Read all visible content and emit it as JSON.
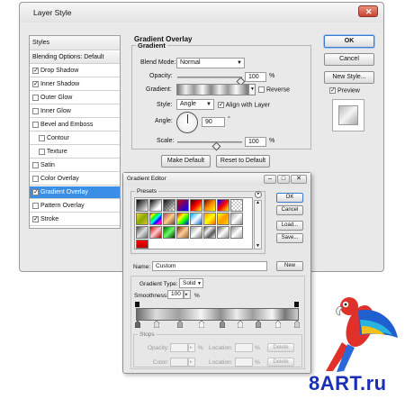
{
  "layer_style": {
    "title": "Layer Style",
    "close_icon": "x-icon",
    "sidebar": {
      "styles_label": "Styles",
      "blending_label": "Blending Options: Default",
      "items": [
        {
          "label": "Drop Shadow",
          "checked": true
        },
        {
          "label": "Inner Shadow",
          "checked": true
        },
        {
          "label": "Outer Glow",
          "checked": false
        },
        {
          "label": "Inner Glow",
          "checked": false
        },
        {
          "label": "Bevel and Emboss",
          "checked": false
        },
        {
          "label": "Contour",
          "checked": false
        },
        {
          "label": "Texture",
          "checked": false
        },
        {
          "label": "Satin",
          "checked": false
        },
        {
          "label": "Color Overlay",
          "checked": false
        },
        {
          "label": "Gradient Overlay",
          "checked": true
        },
        {
          "label": "Pattern Overlay",
          "checked": false
        },
        {
          "label": "Stroke",
          "checked": true
        }
      ]
    },
    "panel": {
      "section_title": "Gradient Overlay",
      "group_title": "Gradient",
      "blend_mode_label": "Blend Mode:",
      "blend_mode_value": "Normal",
      "opacity_label": "Opacity:",
      "opacity_value": "100",
      "opacity_unit": "%",
      "gradient_label": "Gradient:",
      "reverse_label": "Reverse",
      "style_label": "Style:",
      "style_value": "Angle",
      "align_label": "Align with Layer",
      "angle_label": "Angle:",
      "angle_value": "90",
      "angle_unit": "°",
      "scale_label": "Scale:",
      "scale_value": "100",
      "scale_unit": "%",
      "make_default": "Make Default",
      "reset_default": "Reset to Default"
    },
    "buttons": {
      "ok": "OK",
      "cancel": "Cancel",
      "new_style": "New Style...",
      "preview": "Preview"
    }
  },
  "gradient_editor": {
    "title": "Gradient Editor",
    "presets_label": "Presets",
    "buttons": {
      "ok": "OK",
      "cancel": "Cancel",
      "load": "Load...",
      "save": "Save...",
      "new": "New",
      "delete_1": "Delete",
      "delete_2": "Delete"
    },
    "name_label": "Name:",
    "name_value": "Custom",
    "gradient_type_label": "Gradient Type:",
    "gradient_type_value": "Solid",
    "smoothness_label": "Smoothness:",
    "smoothness_value": "100",
    "smoothness_unit": "%",
    "stops_label": "Stops",
    "opacity_label": "Opacity:",
    "opacity_unit": "%",
    "location_label_1": "Location:",
    "location_unit_1": "%",
    "color_label": "Color:",
    "location_label_2": "Location:",
    "location_unit_2": "%"
  },
  "watermark": {
    "text": "8ART.ru",
    "logo": "parrot-logo"
  },
  "colors": {
    "accent": "#3b8ee6",
    "watermark_text": "#1b2fb5",
    "dialog_bg": "#ececec"
  }
}
